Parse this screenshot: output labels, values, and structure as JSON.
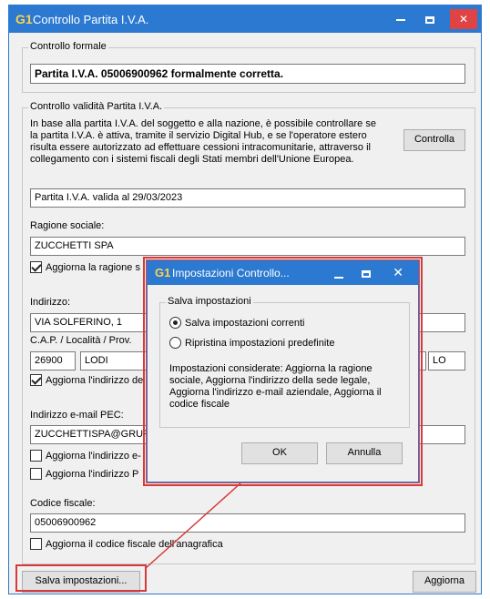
{
  "window": {
    "logo": "G1",
    "title": "Controllo Partita I.V.A."
  },
  "formal": {
    "legend": "Controllo formale",
    "result": "Partita I.V.A. 05006900962 formalmente corretta."
  },
  "validity": {
    "legend": "Controllo validità Partita I.V.A.",
    "description": "In base alla partita I.V.A. del soggetto e alla nazione, è possibile controllare se la partita I.V.A. è attiva, tramite il servizio Digital Hub, e se l'operatore estero risulta essere autorizzato ad effettuare cessioni intracomunitarie, attraverso il collegamento con i sistemi fiscali degli Stati membri dell'Unione Europea.",
    "check_button": "Controlla",
    "result": "Partita I.V.A. valida al 29/03/2023",
    "ragione_label": "Ragione sociale:",
    "ragione_value": "ZUCCHETTI SPA",
    "ragione_check": "Aggiorna la ragione s",
    "indirizzo_label": "Indirizzo:",
    "indirizzo_value": "VIA SOLFERINO, 1",
    "cap_label": "C.A.P. / Località / Prov.",
    "cap_value": "26900",
    "localita_value": "LODI",
    "prov_value": "LO",
    "indirizzo_check": "Aggiorna l'indirizzo de",
    "pec_label": "Indirizzo e-mail PEC:",
    "pec_value": "ZUCCHETTISPA@GRUP",
    "pec_check1": "Aggiorna l'indirizzo e-",
    "pec_check2": "Aggiorna l'indirizzo P",
    "cf_label": "Codice fiscale:",
    "cf_value": "05006900962",
    "cf_check": "Aggiorna il codice fiscale dell'anagrafica"
  },
  "footer": {
    "save_settings": "Salva impostazioni...",
    "update": "Aggiorna"
  },
  "dialog": {
    "logo": "G1",
    "title": "Impostazioni Controllo...",
    "group_legend": "Salva impostazioni",
    "option_save": "Salva impostazioni correnti",
    "option_restore": "Ripristina impostazioni predefinite",
    "info": "Impostazioni considerate: Aggiorna la ragione sociale, Aggiorna l'indirizzo della sede legale, Aggiorna l'indirizzo e-mail aziendale, Aggiorna il codice fiscale",
    "ok": "OK",
    "cancel": "Annulla"
  },
  "colors": {
    "titlebar": "#2b79d0",
    "close": "#e04343",
    "highlight": "#d63a3a"
  }
}
